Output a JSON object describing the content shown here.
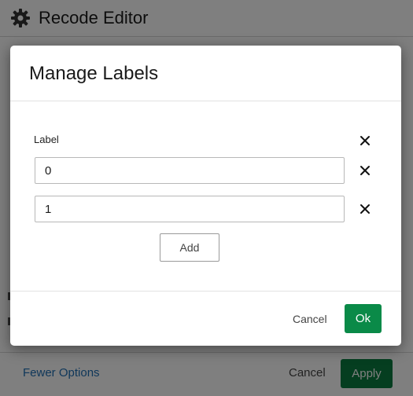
{
  "background": {
    "title": "Recode Editor",
    "footer": {
      "fewer_options_label": "Fewer Options",
      "cancel_label": "Cancel",
      "apply_label": "Apply"
    }
  },
  "modal": {
    "title": "Manage Labels",
    "column_header": "Label",
    "labels": [
      {
        "value": "0"
      },
      {
        "value": "1"
      }
    ],
    "add_label": "Add",
    "cancel_label": "Cancel",
    "ok_label": "Ok"
  },
  "colors": {
    "primary_green": "#0a8a48",
    "link_blue": "#1f6fb5"
  },
  "icons": {
    "header": "gear-icon",
    "remove": "close-icon"
  }
}
